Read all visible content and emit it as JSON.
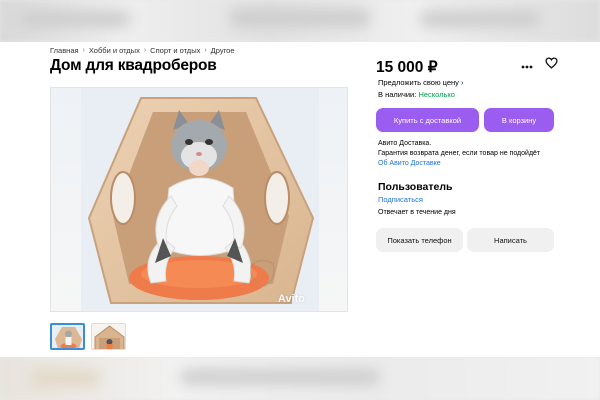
{
  "breadcrumbs": [
    "Главная",
    "Хобби и отдых",
    "Спорт и отдых",
    "Другое"
  ],
  "breadcrumb_separator": "›",
  "title": "Дом для квадроберов",
  "photo": {
    "watermark": "Avito"
  },
  "thumbnails": [
    "photo-1",
    "photo-2"
  ],
  "price": "15 000 ₽",
  "icons": {
    "more": "more-dots-icon",
    "favorite": "heart-icon"
  },
  "offer_price": "Предложить свою цену ›",
  "stock": {
    "label": "В наличии:",
    "value": "Несколько",
    "value_color": "#04a04a"
  },
  "buttons": {
    "buy_delivery": "Купить с доставкой",
    "to_cart": "В корзину",
    "show_phone": "Показать телефон",
    "write": "Написать"
  },
  "delivery": {
    "line1": "Авито Доставка.",
    "line2": "Гарантия возврата денег, если товар не подойдёт",
    "link": "Об Авито Доставке"
  },
  "seller": {
    "name": "Пользователь",
    "subscribe": "Подписаться",
    "reply_time": "Отвечает в течение дня"
  },
  "colors": {
    "accent": "#9b5cf0",
    "link": "#1e73d8",
    "in_stock": "#04a04a"
  }
}
